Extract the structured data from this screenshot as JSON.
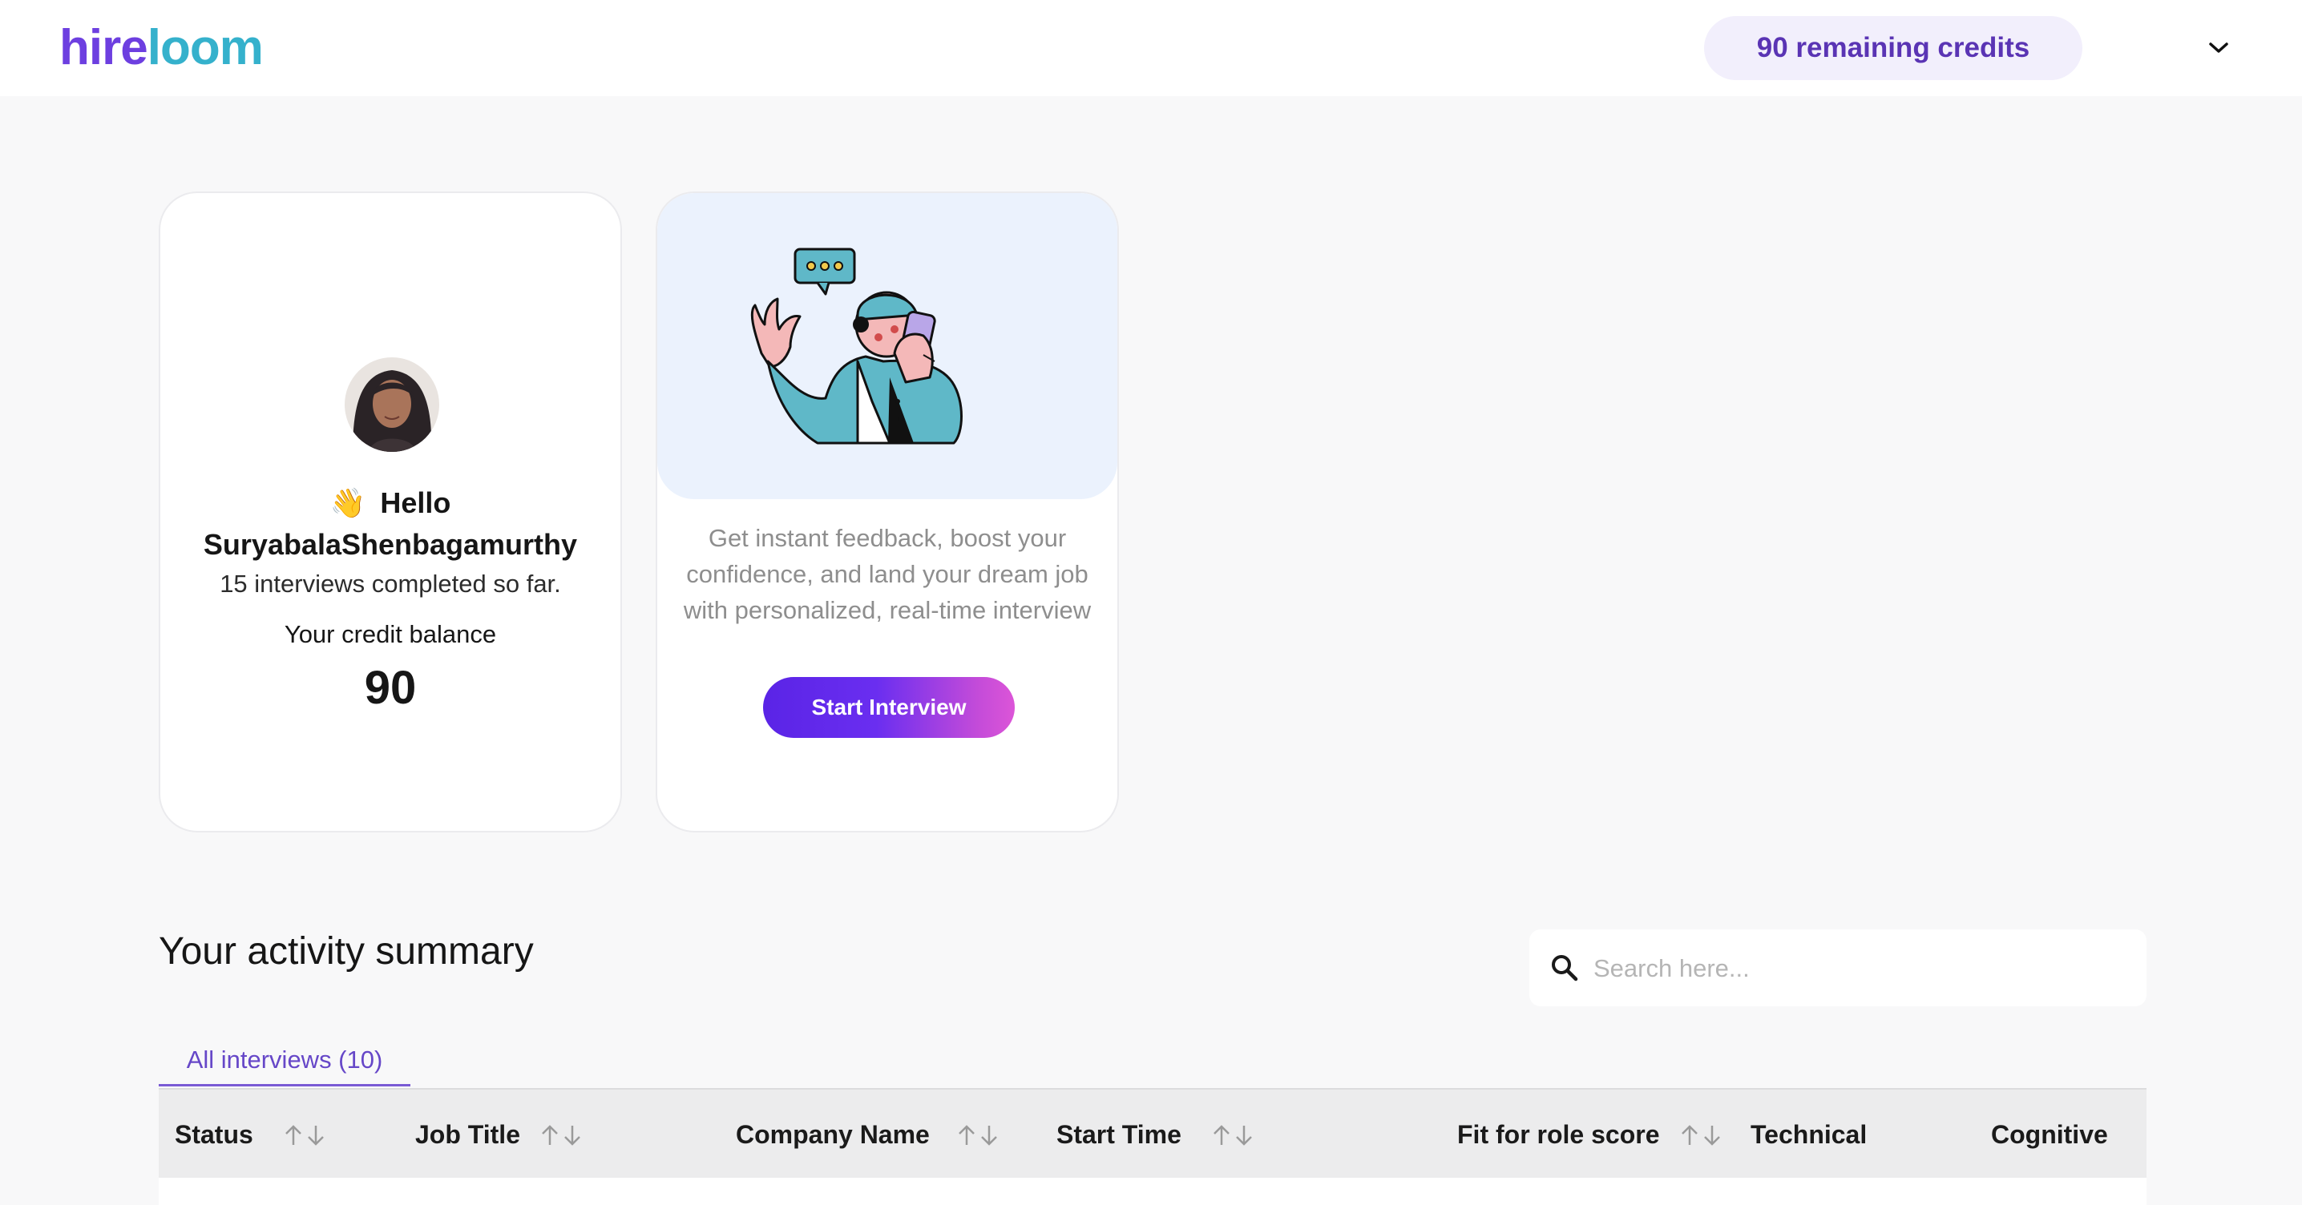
{
  "brand": {
    "logo_part1": "hire",
    "logo_part2": "loom"
  },
  "header": {
    "credits_label": "90 remaining credits",
    "chevron_icon": "chevron-down-icon"
  },
  "profile": {
    "greeting_emoji": "👋",
    "greeting": "Hello",
    "username": "SuryabalaShenbagamurthy",
    "interviews_completed": "15 interviews completed so far.",
    "credit_balance_label": "Your credit balance",
    "credit_balance": "90"
  },
  "cta": {
    "description": "Get instant feedback, boost your confidence, and land your dream job with personalized, real-time interview",
    "button_label": "Start Interview"
  },
  "activity": {
    "title": "Your activity summary",
    "search_placeholder": "Search here...",
    "tabs": [
      {
        "label": "All interviews (10)"
      }
    ],
    "columns": [
      "Status",
      "Job Title",
      "Company Name",
      "Start Time",
      "Fit for role score",
      "Technical",
      "Cognitive"
    ]
  },
  "colors": {
    "brand_purple": "#6d3fe0",
    "brand_teal": "#35b1cc",
    "button_gradient_start": "#5a24e6",
    "button_gradient_end": "#dc55d8"
  }
}
